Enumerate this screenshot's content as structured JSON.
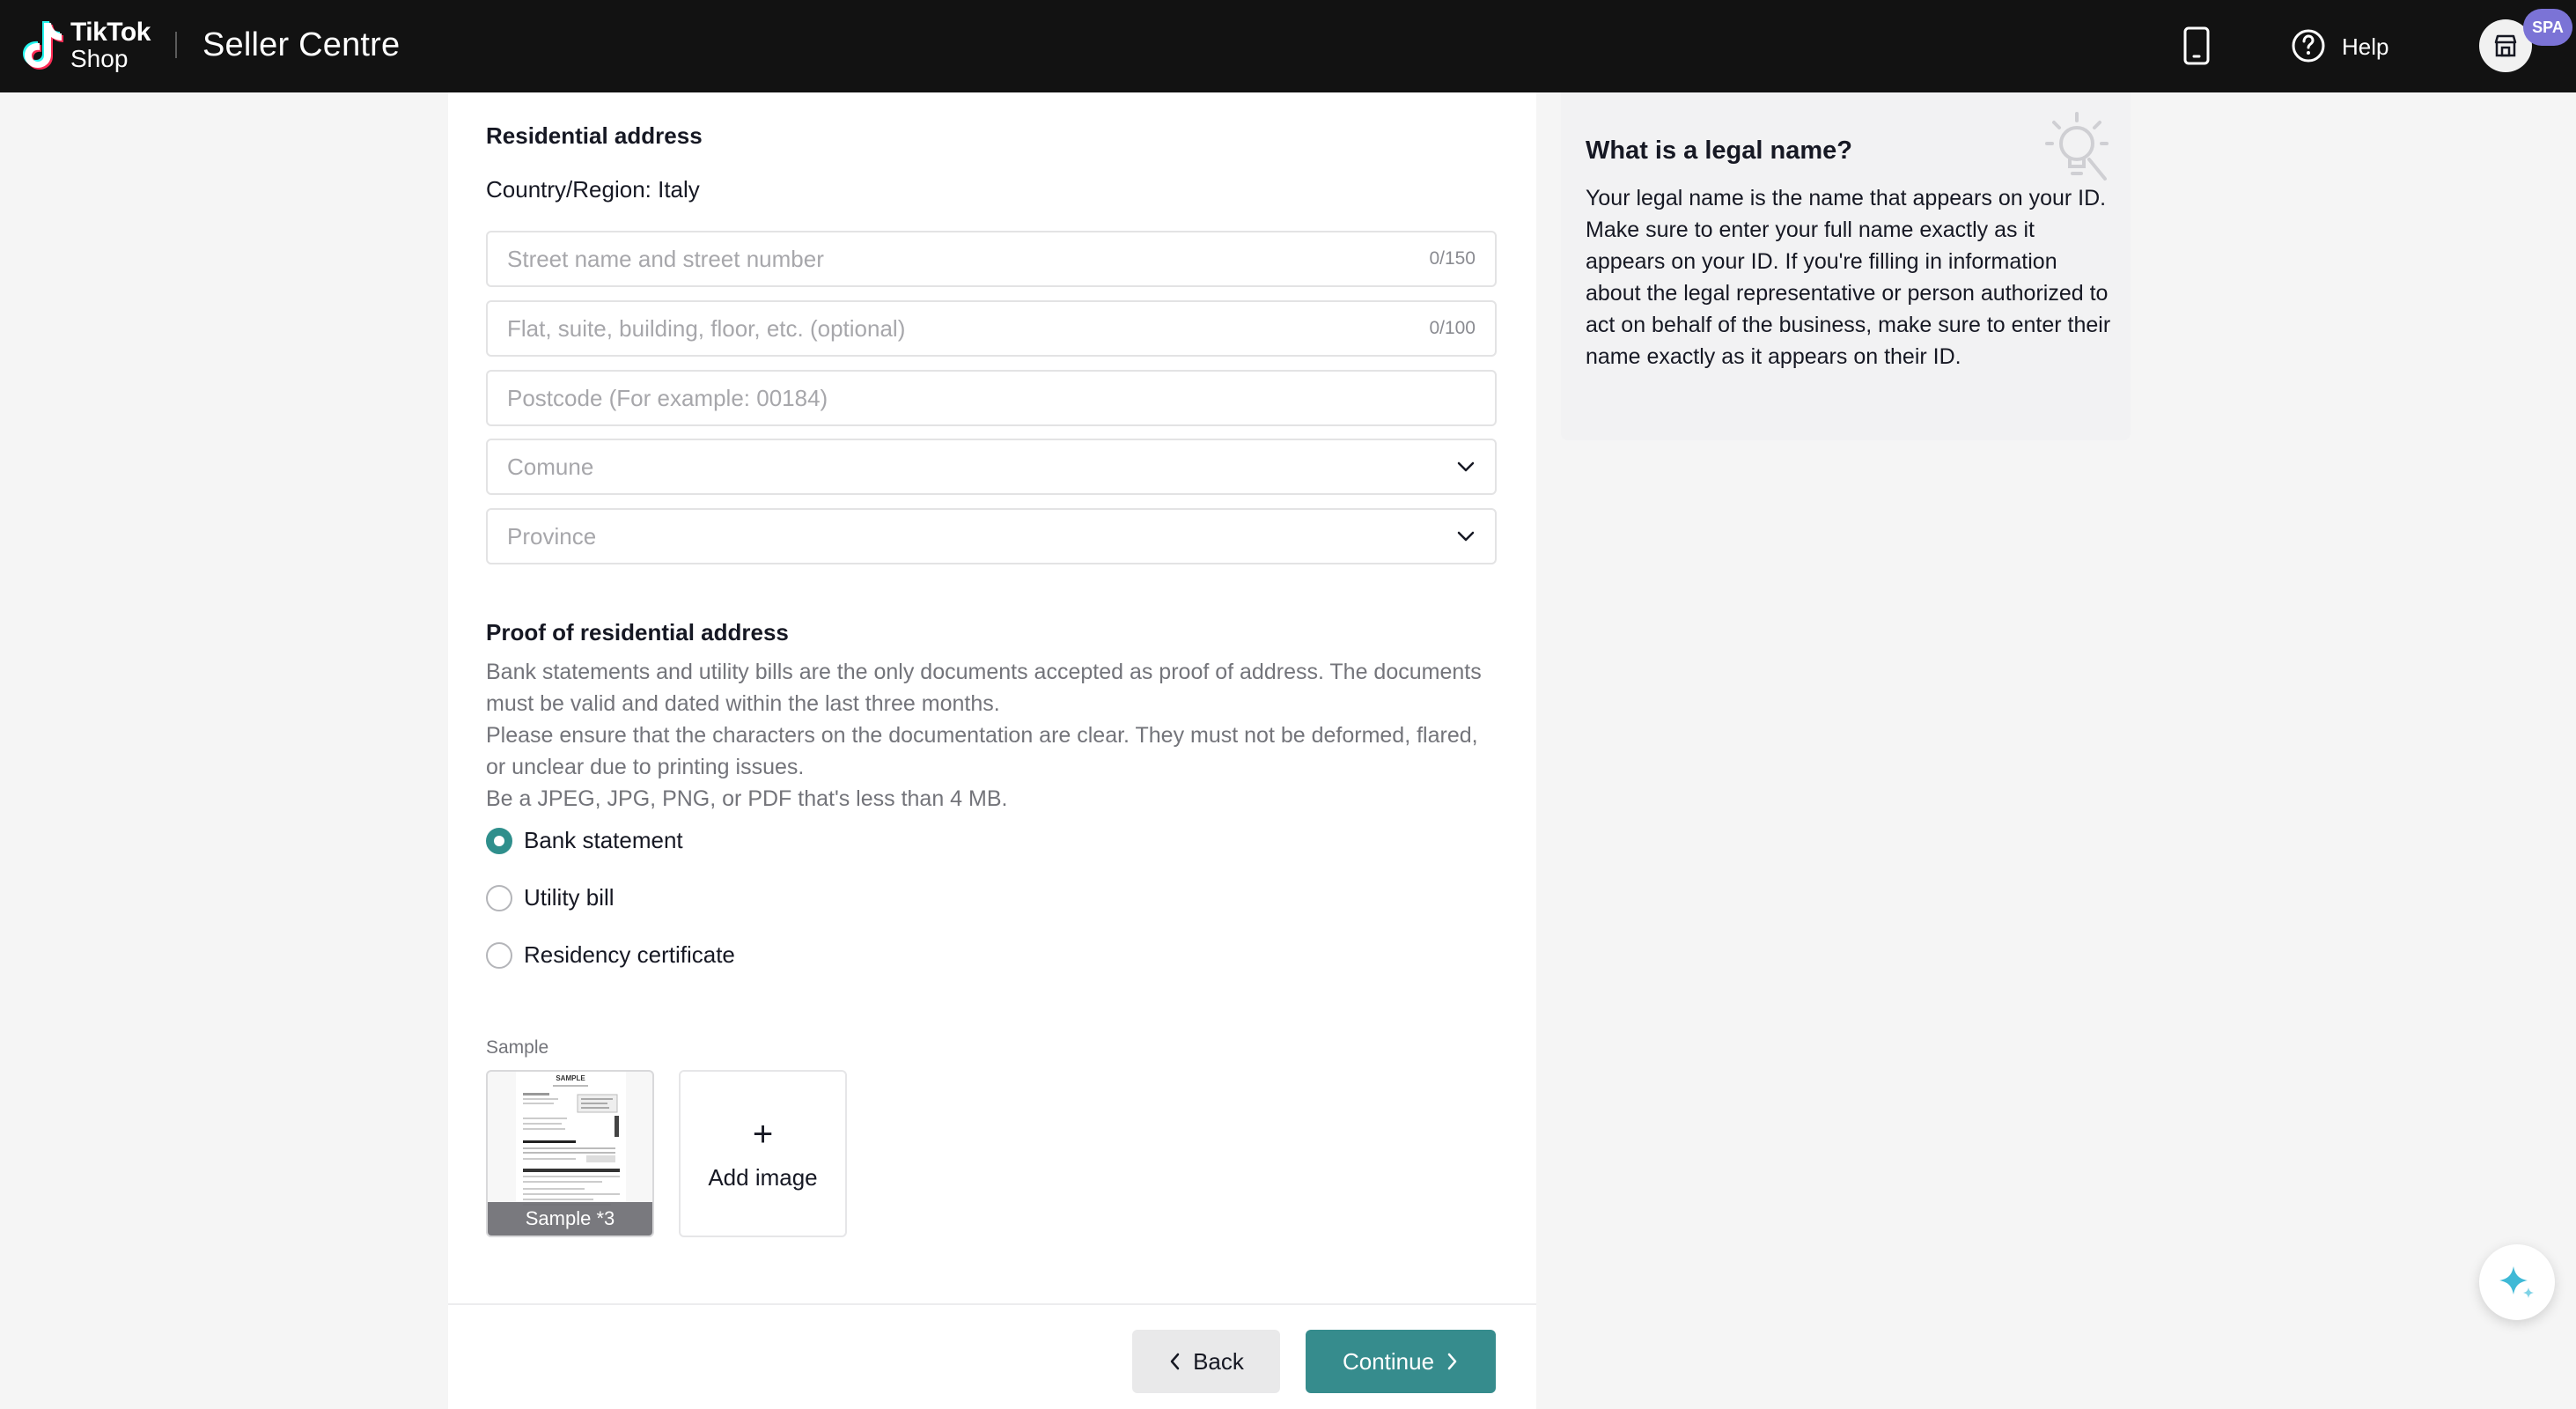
{
  "header": {
    "logo_line1": "TikTok",
    "logo_line2": "Shop",
    "product_title": "Seller Centre",
    "help_label": "Help",
    "account_badge": "SPA",
    "icons": [
      "tiktok-logo-icon",
      "mobile-phone-icon",
      "help-circle-icon",
      "store-icon"
    ]
  },
  "address": {
    "section_title": "Residential address",
    "country_line": "Country/Region: Italy",
    "street": {
      "placeholder": "Street name and street number",
      "value": "",
      "counter": "0/150"
    },
    "flat": {
      "placeholder": "Flat, suite, building, floor, etc. (optional)",
      "value": "",
      "counter": "0/100"
    },
    "postcode": {
      "placeholder": "Postcode (For example: 00184)",
      "value": ""
    },
    "comune": {
      "placeholder": "Comune",
      "value": ""
    },
    "province": {
      "placeholder": "Province",
      "value": ""
    }
  },
  "proof": {
    "section_title": "Proof of residential address",
    "description_lines": [
      "Bank statements and utility bills are the only documents accepted as proof of address. The documents must be valid and dated within the last three months.",
      "Please ensure that the characters on the documentation are clear. They must not be deformed, flared, or unclear due to printing issues.",
      "Be a JPEG, JPG, PNG, or PDF that's less than 4 MB."
    ],
    "options": [
      {
        "label": "Bank statement",
        "selected": true
      },
      {
        "label": "Utility bill",
        "selected": false
      },
      {
        "label": "Residency certificate",
        "selected": false
      }
    ],
    "sample_label": "Sample",
    "sample_caption": "Sample *3",
    "sample_doc_heading": "SAMPLE",
    "add_image_plus": "+",
    "add_image_label": "Add image"
  },
  "footer": {
    "back_label": "Back",
    "continue_label": "Continue"
  },
  "tip": {
    "title": "What is a legal name?",
    "body": "Your legal name is the name that appears on your ID. Make sure to enter your full name exactly as it appears on your ID. If you're filling in information about the legal representative or person authorized to act on behalf of the business, make sure to enter their name exactly as it appears on their ID."
  },
  "colors": {
    "topbar": "#121212",
    "accent_teal": "#368c8d",
    "radio_selected": "#2f8f8c",
    "badge": "#7b73d6",
    "fab_sparkle": "#3fb9d6"
  }
}
